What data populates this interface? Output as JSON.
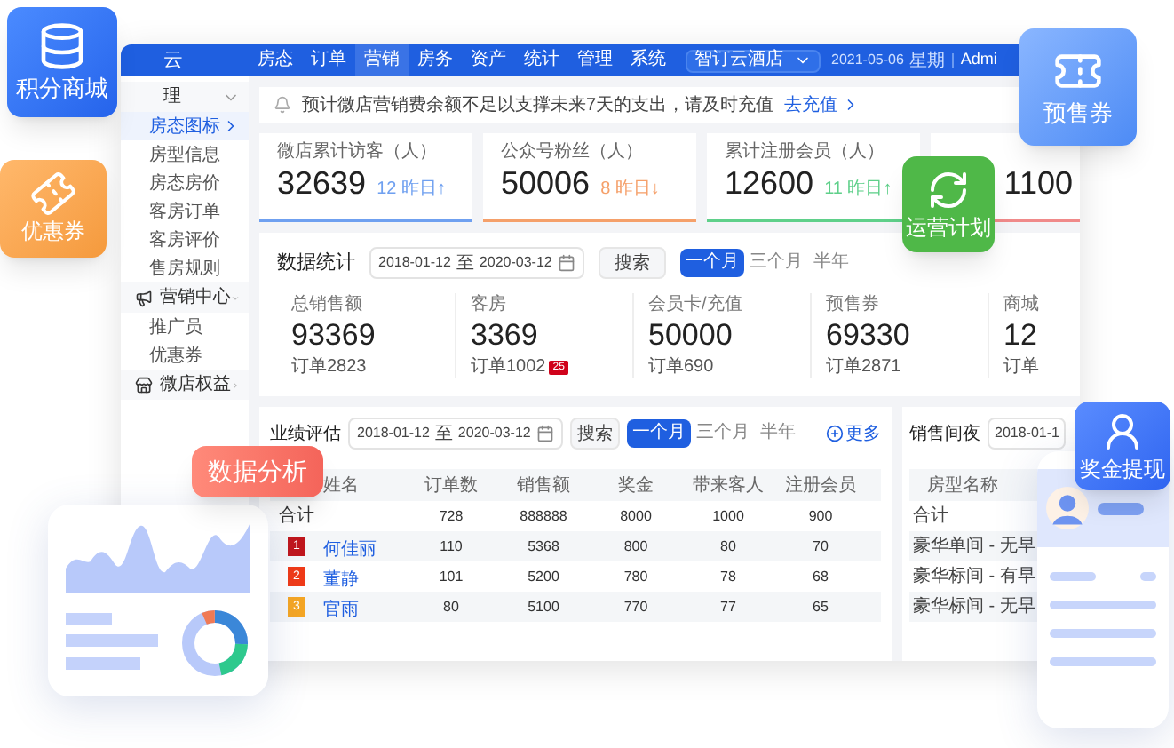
{
  "badges": [
    {
      "kind": "points",
      "label": "积分商城"
    },
    {
      "kind": "coupon",
      "label": "优惠券"
    },
    {
      "kind": "presale",
      "label": "预售券"
    },
    {
      "kind": "operation",
      "label": "运营计划"
    },
    {
      "kind": "bonus",
      "label": "奖金提现"
    },
    {
      "kind": "analysis",
      "label": "数据分析"
    }
  ],
  "nav": {
    "logo": "云",
    "items": [
      {
        "label": "房态",
        "selected": false
      },
      {
        "label": "订单",
        "selected": false
      },
      {
        "label": "营销",
        "selected": true
      },
      {
        "label": "房务",
        "selected": false
      },
      {
        "label": "资产",
        "selected": false
      },
      {
        "label": "统计",
        "selected": false
      },
      {
        "label": "管理",
        "selected": false
      },
      {
        "label": "系统",
        "selected": false
      }
    ],
    "store_select": "智订云酒店",
    "date": "2021-05-06",
    "weekday": "星期",
    "user": "Admi"
  },
  "sidebar": {
    "groups": [
      {
        "label": "理",
        "expanded": true,
        "children": [
          {
            "label": "房态图标",
            "selected": true
          },
          {
            "label": "房型信息",
            "selected": false
          },
          {
            "label": "房态房价",
            "selected": false
          },
          {
            "label": "客房订单",
            "selected": false
          },
          {
            "label": "客房评价",
            "selected": false
          },
          {
            "label": "售房规则",
            "selected": false
          }
        ]
      },
      {
        "label": "营销中心",
        "expanded": true,
        "children": [
          {
            "label": "推广员",
            "selected": false
          },
          {
            "label": "优惠券",
            "selected": false
          }
        ]
      },
      {
        "label": "微店权益",
        "expanded": false
      }
    ]
  },
  "notice": {
    "text": "预计微店营销费余额不足以支撑未来7天的支出，请及时充值",
    "link": "去充值"
  },
  "stat_cards": [
    {
      "label": "微店累计访客（人）",
      "value": "32639",
      "delta": "12 昨日↑",
      "color": "#6fa0f0"
    },
    {
      "label": "公众号粉丝（人）",
      "value": "50006",
      "delta": "8 昨日↓",
      "color": "#f5a06a"
    },
    {
      "label": "累计注册会员（人）",
      "value": "12600",
      "delta": "11 昨日↑",
      "color": "#5fd08a"
    },
    {
      "value": "1100",
      "color": "#f08a8a"
    }
  ],
  "data_stats": {
    "title": "数据统计",
    "date_from": "2018-01-12",
    "date_sep": "至",
    "date_to": "2020-03-12",
    "search": "搜索",
    "periods": [
      {
        "label": "一个月",
        "selected": true
      },
      {
        "label": "三个月",
        "selected": false
      },
      {
        "label": "半年",
        "selected": false
      }
    ],
    "metrics": [
      {
        "label": "总销售额",
        "value": "93369",
        "orders": "订单2823"
      },
      {
        "label": "客房",
        "value": "3369",
        "orders": "订单1002",
        "badge": "25"
      },
      {
        "label": "会员卡/充值",
        "value": "50000",
        "orders": "订单690"
      },
      {
        "label": "预售券",
        "value": "69330",
        "orders": "订单2871"
      },
      {
        "label": "商城",
        "value": "12",
        "orders": "订单"
      }
    ]
  },
  "performance": {
    "title": "业绩评估",
    "date_from": "2018-01-12",
    "date_sep": "至",
    "date_to": "2020-03-12",
    "search": "搜索",
    "periods": [
      {
        "label": "一个月",
        "selected": true
      },
      {
        "label": "三个月",
        "selected": false
      },
      {
        "label": "半年",
        "selected": false
      }
    ],
    "more": "更多",
    "columns": [
      "姓名",
      "订单数",
      "销售额",
      "奖金",
      "带来客人",
      "注册会员"
    ],
    "rows": [
      {
        "kind": "total",
        "label": "合计",
        "values": [
          "728",
          "888888",
          "8000",
          "1000",
          "900"
        ]
      },
      {
        "kind": "ranked",
        "rank": "1",
        "color": "#c0161c",
        "name": "何佳丽",
        "values": [
          "110",
          "5368",
          "800",
          "80",
          "70"
        ]
      },
      {
        "kind": "ranked",
        "rank": "2",
        "color": "#f03a17",
        "name": "董静",
        "values": [
          "101",
          "5200",
          "780",
          "78",
          "68"
        ]
      },
      {
        "kind": "ranked",
        "rank": "3",
        "color": "#f5a623",
        "name": "官雨",
        "values": [
          "80",
          "5100",
          "770",
          "77",
          "65"
        ]
      }
    ]
  },
  "room_nights": {
    "title": "销售间夜",
    "date_range": "2018-01-1",
    "column": "房型名称",
    "rows": [
      "合计",
      "豪华单间 - 无早",
      "豪华标间 - 有早",
      "豪华标间 - 无早"
    ]
  }
}
